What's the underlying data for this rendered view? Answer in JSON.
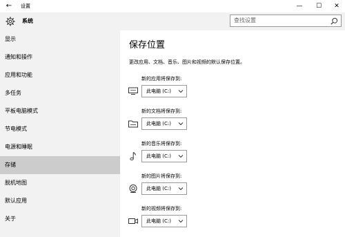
{
  "window": {
    "title": "设置",
    "back_glyph": "←",
    "minimize_glyph": "—",
    "maximize_glyph": "☐",
    "close_glyph": "✕"
  },
  "sidebar": {
    "header": "系统",
    "items": [
      {
        "label": "显示",
        "active": false
      },
      {
        "label": "通知和操作",
        "active": false
      },
      {
        "label": "应用和功能",
        "active": false
      },
      {
        "label": "多任务",
        "active": false
      },
      {
        "label": "平板电脑模式",
        "active": false
      },
      {
        "label": "节电模式",
        "active": false
      },
      {
        "label": "电源和睡眠",
        "active": false
      },
      {
        "label": "存储",
        "active": true
      },
      {
        "label": "脱机地图",
        "active": false
      },
      {
        "label": "默认应用",
        "active": false
      },
      {
        "label": "关于",
        "active": false
      }
    ]
  },
  "search": {
    "placeholder": "查找设置",
    "icon": "search-icon"
  },
  "main": {
    "title": "保存位置",
    "description": "更改应用、文档、音乐、图片和视频的默认保存位置。",
    "locations": [
      {
        "label": "新的应用将保存到:",
        "value": "此电脑 (C:)",
        "icon": "monitor-icon"
      },
      {
        "label": "新的文档将保存到:",
        "value": "此电脑 (C:)",
        "icon": "folder-icon"
      },
      {
        "label": "新的音乐将保存到:",
        "value": "此电脑 (C:)",
        "icon": "music-note-icon"
      },
      {
        "label": "新的图片将保存到:",
        "value": "此电脑 (C:)",
        "icon": "camera-icon"
      },
      {
        "label": "新的视频将保存到:",
        "value": "此电脑 (C:)",
        "icon": "video-camera-icon"
      }
    ]
  },
  "colors": {
    "sidebar_bg": "#f2f2f2",
    "active_item_bg": "#cccccc",
    "main_bg": "#ffffff"
  }
}
